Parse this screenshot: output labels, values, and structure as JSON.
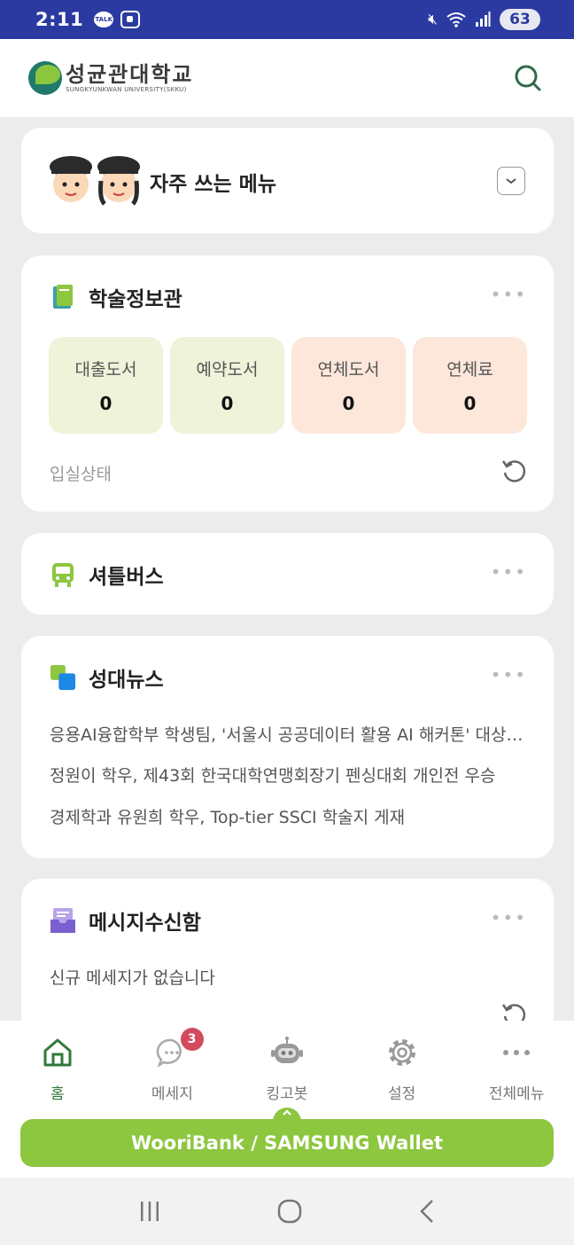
{
  "status_bar": {
    "time": "2:11",
    "talk_label": "TALK",
    "battery": "63"
  },
  "header": {
    "logo_ko": "성균관대학교",
    "logo_en": "SUNGKYUNKWAN UNIVERSITY(SKKU)"
  },
  "favorites": {
    "title": "자주 쓰는 메뉴"
  },
  "library": {
    "title": "학술정보관",
    "stats": [
      {
        "label": "대출도서",
        "value": "0"
      },
      {
        "label": "예약도서",
        "value": "0"
      },
      {
        "label": "연체도서",
        "value": "0"
      },
      {
        "label": "연체료",
        "value": "0"
      }
    ],
    "entry_status": "입실상태"
  },
  "shuttle": {
    "title": "셔틀버스"
  },
  "news": {
    "title": "성대뉴스",
    "items": [
      "응용AI융합학부 학생팀, '서울시 공공데이터 활용 AI 해커톤' 대상 수상",
      "정원이 학우, 제43회 한국대학연맹회장기 펜싱대회 개인전 우승",
      "경제학과 유원희 학우, Top-tier SSCI 학술지 게재"
    ]
  },
  "inbox": {
    "title": "메시지수신함",
    "empty_message": "신규 메세지가 없습니다"
  },
  "nav": {
    "items": [
      {
        "label": "홈"
      },
      {
        "label": "메세지",
        "badge": "3"
      },
      {
        "label": "킹고봇"
      },
      {
        "label": "설정"
      },
      {
        "label": "전체메뉴"
      }
    ]
  },
  "wallet": {
    "label": "WooriBank / SAMSUNG Wallet"
  },
  "colors": {
    "accent_green": "#8dc63f",
    "status_bar": "#2b3aa1",
    "badge": "#d24b5d"
  }
}
